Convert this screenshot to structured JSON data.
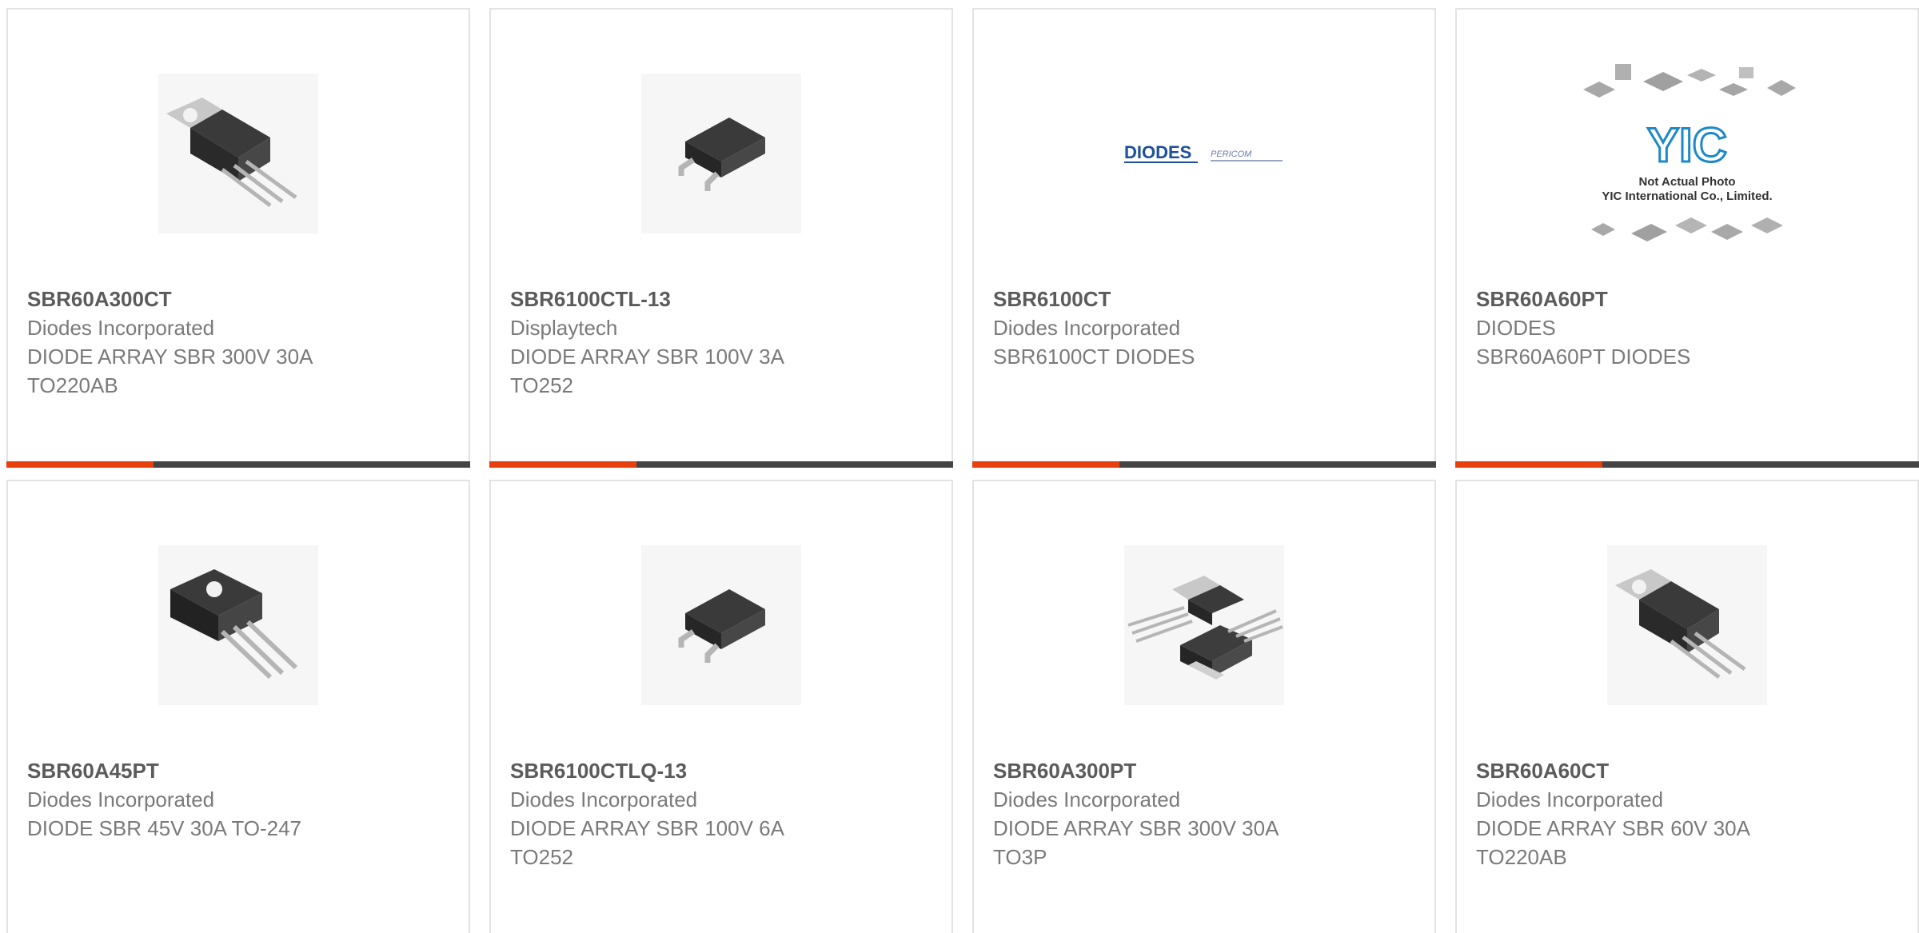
{
  "colors": {
    "accent": "#e8400c",
    "bar": "#444444",
    "border": "#e3e3e3",
    "part_text": "#5b5b5b",
    "body_text": "#7a7a7a",
    "diodes_logo": "#1d4f9c",
    "yic_logo": "#1e88c9"
  },
  "products": [
    {
      "part": "SBR60A300CT",
      "maker": "Diodes Incorporated",
      "desc1": "DIODE ARRAY SBR 300V 30A",
      "desc2": "TO220AB",
      "icon": "to220-package-icon"
    },
    {
      "part": "SBR6100CTL-13",
      "maker": "Displaytech",
      "desc1": "DIODE ARRAY SBR 100V 3A",
      "desc2": "TO252",
      "icon": "to252-package-icon"
    },
    {
      "part": "SBR6100CT",
      "maker": "Diodes Incorporated",
      "desc1": "SBR6100CT DIODES",
      "desc2": "",
      "icon": "diodes-pericom-logo",
      "logo_text_1": "DIODES",
      "logo_text_2": "PERICOM"
    },
    {
      "part": "SBR60A60PT",
      "maker": "DIODES",
      "desc1": "SBR60A60PT DIODES",
      "desc2": "",
      "icon": "yic-placeholder-logo",
      "logo_text_1": "YIC",
      "logo_text_2": "Not Actual Photo",
      "logo_text_3": "YIC International Co., Limited."
    },
    {
      "part": "SBR60A45PT",
      "maker": "Diodes Incorporated",
      "desc1": "DIODE SBR 45V 30A TO-247",
      "desc2": "",
      "icon": "to247-package-icon"
    },
    {
      "part": "SBR6100CTLQ-13",
      "maker": "Diodes Incorporated",
      "desc1": "DIODE ARRAY SBR 100V 6A",
      "desc2": "TO252",
      "icon": "to252-package-icon"
    },
    {
      "part": "SBR60A300PT",
      "maker": "Diodes Incorporated",
      "desc1": "DIODE ARRAY SBR 300V 30A",
      "desc2": "TO3P",
      "icon": "to3p-package-icon"
    },
    {
      "part": "SBR60A60CT",
      "maker": "Diodes Incorporated",
      "desc1": "DIODE ARRAY SBR 60V 30A",
      "desc2": "TO220AB",
      "icon": "to220-package-icon"
    }
  ]
}
